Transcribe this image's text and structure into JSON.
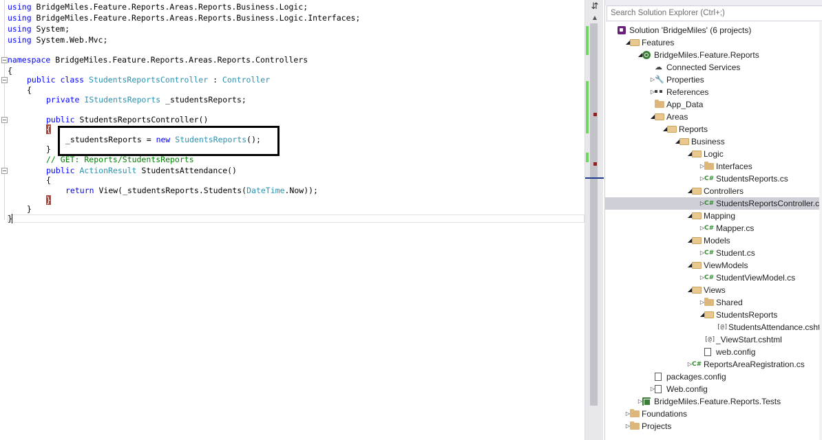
{
  "editor": {
    "lines": {
      "l1": {
        "kw": "using",
        "rest": " BridgeMiles.Feature.Reports.Areas.Reports.Business.Logic;"
      },
      "l2": {
        "kw": "using",
        "rest": " BridgeMiles.Feature.Reports.Areas.Reports.Business.Logic.Interfaces;"
      },
      "l3": {
        "kw": "using",
        "rest": " System;"
      },
      "l4": {
        "kw": "using",
        "rest": " System.Web.Mvc;"
      },
      "l5": {
        "kw": "namespace",
        "rest": " BridgeMiles.Feature.Reports.Areas.Reports.Controllers"
      },
      "l6": {
        "text": "{"
      },
      "l7": {
        "kw1": "public",
        "kw2": "class",
        "type1": "StudentsReportsController",
        "sep": " : ",
        "type2": "Controller"
      },
      "l8": {
        "text": "{"
      },
      "l9": {
        "kw": "private",
        "type": "IStudentsReports",
        "rest": " _studentsReports;"
      },
      "l10": {
        "kw": "public",
        "rest": " StudentsReportsController()"
      },
      "l11": {
        "text": "{"
      },
      "l12": {
        "pre": "_studentsReports = ",
        "kw": "new",
        "type": "StudentsReports",
        "post": "();"
      },
      "l13": {
        "text": "}"
      },
      "l14": {
        "comment": "// GET: Reports/StudentsReports"
      },
      "l15": {
        "kw": "public",
        "type": "ActionResult",
        "rest": " StudentsAttendance()"
      },
      "l16": {
        "text": "{"
      },
      "l17": {
        "kw": "return",
        "pre": " View(_studentsReports.Students(",
        "type": "DateTime",
        "post": ".Now));"
      },
      "l18": {
        "text": "}"
      },
      "l19": {
        "text": "}"
      },
      "l20": {
        "text": "}"
      }
    }
  },
  "scrollbar": {
    "split_glyph": "⇵",
    "up_glyph": "▲"
  },
  "explorer": {
    "search_placeholder": "Search Solution Explorer (Ctrl+;)",
    "nodes": [
      {
        "label": "Solution 'BridgeMiles' (6 projects)",
        "icon": "solution-icon"
      },
      {
        "label": "Features",
        "icon": "folder-open-icon",
        "exp": "◢"
      },
      {
        "label": "BridgeMiles.Feature.Reports",
        "icon": "web-project-icon",
        "exp": "◢"
      },
      {
        "label": "Connected Services",
        "icon": "connected-services-icon"
      },
      {
        "label": "Properties",
        "icon": "wrench-icon",
        "exp": "▷"
      },
      {
        "label": "References",
        "icon": "references-icon",
        "exp": "▷"
      },
      {
        "label": "App_Data",
        "icon": "folder-icon"
      },
      {
        "label": "Areas",
        "icon": "folder-open-icon",
        "exp": "◢"
      },
      {
        "label": "Reports",
        "icon": "folder-open-icon",
        "exp": "◢"
      },
      {
        "label": "Business",
        "icon": "folder-open-icon",
        "exp": "◢"
      },
      {
        "label": "Logic",
        "icon": "folder-open-icon",
        "exp": "◢"
      },
      {
        "label": "Interfaces",
        "icon": "folder-icon",
        "exp": "▷"
      },
      {
        "label": "StudentsReports.cs",
        "icon": "csharp-file-icon",
        "exp": "▷"
      },
      {
        "label": "Controllers",
        "icon": "folder-open-icon",
        "exp": "◢"
      },
      {
        "label": "StudentsReportsController.cs",
        "icon": "csharp-file-icon",
        "exp": "▷"
      },
      {
        "label": "Mapping",
        "icon": "folder-open-icon",
        "exp": "◢"
      },
      {
        "label": "Mapper.cs",
        "icon": "csharp-file-icon",
        "exp": "▷"
      },
      {
        "label": "Models",
        "icon": "folder-open-icon",
        "exp": "◢"
      },
      {
        "label": "Student.cs",
        "icon": "csharp-file-icon",
        "exp": "▷"
      },
      {
        "label": "ViewModels",
        "icon": "folder-open-icon",
        "exp": "◢"
      },
      {
        "label": "StudentViewModel.cs",
        "icon": "csharp-file-icon",
        "exp": "▷"
      },
      {
        "label": "Views",
        "icon": "folder-open-icon",
        "exp": "◢"
      },
      {
        "label": "Shared",
        "icon": "folder-icon",
        "exp": "▷"
      },
      {
        "label": "StudentsReports",
        "icon": "folder-open-icon",
        "exp": "◢"
      },
      {
        "label": "StudentsAttendance.cshtml",
        "icon": "cshtml-file-icon"
      },
      {
        "label": "_ViewStart.cshtml",
        "icon": "cshtml-file-icon"
      },
      {
        "label": "web.config",
        "icon": "config-file-icon"
      },
      {
        "label": "ReportsAreaRegistration.cs",
        "icon": "csharp-file-icon",
        "exp": "▷"
      },
      {
        "label": "packages.config",
        "icon": "config-file-icon"
      },
      {
        "label": "Web.config",
        "icon": "config-file-icon",
        "exp": "▷"
      },
      {
        "label": "BridgeMiles.Feature.Reports.Tests",
        "icon": "test-project-icon",
        "exp": "▷"
      },
      {
        "label": "Foundations",
        "icon": "folder-icon",
        "exp": "▷"
      },
      {
        "label": "Projects",
        "icon": "folder-icon",
        "exp": "▷"
      }
    ],
    "glyphs": {
      "csharp": "C#",
      "cshtml": "[@]",
      "wrench": "🔧",
      "cloud": "☁"
    }
  },
  "colors": {
    "keyword": "#0000ff",
    "type": "#2b91af",
    "comment": "#008000",
    "selection": "#cfcfd7"
  }
}
